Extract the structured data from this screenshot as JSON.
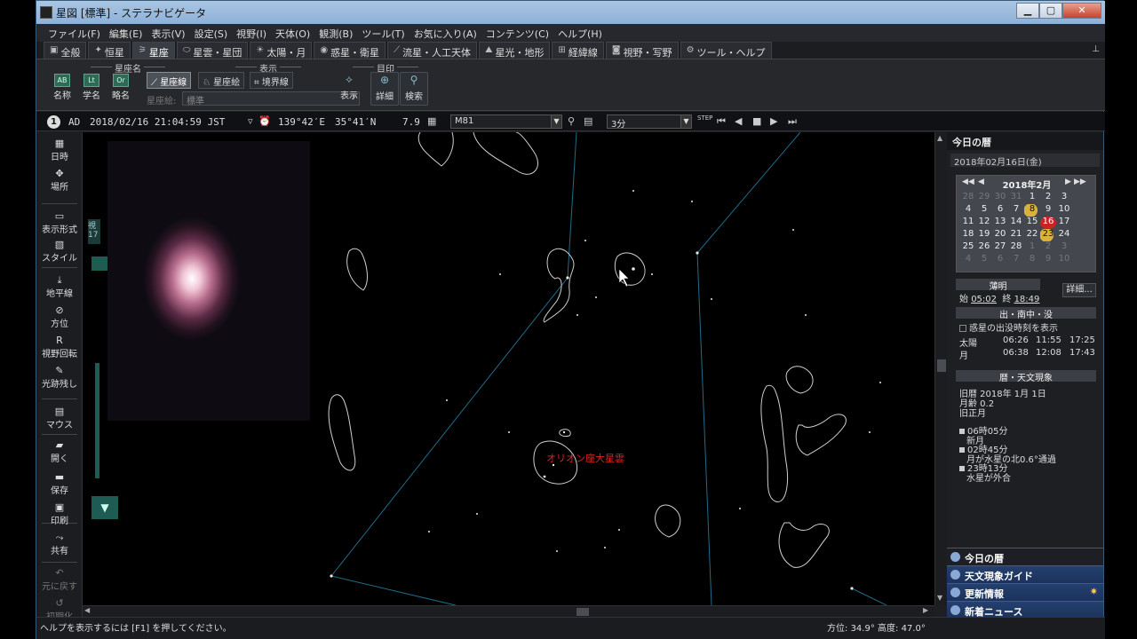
{
  "window": {
    "title": "星図 [標準] - ステラナビゲータ"
  },
  "menu": [
    "ファイル(F)",
    "編集(E)",
    "表示(V)",
    "設定(S)",
    "視野(I)",
    "天体(O)",
    "観測(B)",
    "ツール(T)",
    "お気に入り(A)",
    "コンテンツ(C)",
    "ヘルプ(H)"
  ],
  "tabs": [
    {
      "label": "全般",
      "icon": "grid-icon"
    },
    {
      "label": "恒星",
      "icon": "star-icon"
    },
    {
      "label": "星座",
      "icon": "constellation-icon",
      "active": true
    },
    {
      "label": "星雲・星団",
      "icon": "nebula-icon"
    },
    {
      "label": "太陽・月",
      "icon": "sun-icon"
    },
    {
      "label": "惑星・衛星",
      "icon": "planet-icon"
    },
    {
      "label": "流星・人工天体",
      "icon": "meteor-icon"
    },
    {
      "label": "星光・地形",
      "icon": "landscape-icon"
    },
    {
      "label": "経緯線",
      "icon": "grid-lines-icon"
    },
    {
      "label": "視野・写野",
      "icon": "camera-icon"
    },
    {
      "label": "ツール・ヘルプ",
      "icon": "gear-icon"
    }
  ],
  "ribbon": {
    "group_names": "星座名",
    "group_display": "表示",
    "group_mark": "目印",
    "name_btn": "名称",
    "latin_btn": "学名",
    "abbr_btn": "略名",
    "lines_btn": "星座線",
    "art_btn": "星座絵",
    "boundary_btn": "境界線",
    "art_label": "星座絵:",
    "art_value": "標準",
    "show_btn": "表示",
    "detail_btn": "詳細",
    "search_btn": "検索"
  },
  "status": {
    "circle": "1",
    "era": "AD",
    "datetime": "2018/02/16 21:04:59 JST",
    "longitude": "139°42′E",
    "latitude": "35°41′N",
    "magnitude": "7.9",
    "target": "M81",
    "step": "3分"
  },
  "left_toolbar": [
    "日時",
    "場所",
    "表示形式",
    "スタイル",
    "地平線",
    "方位",
    "視野回転",
    "光跡残し",
    "マウス",
    "開く",
    "保存",
    "印刷",
    "共有",
    "元に戻す",
    "初期化"
  ],
  "sky": {
    "object_label": "オリオン座大星雲",
    "side_text": "視",
    "side_num": "17"
  },
  "right_panel": {
    "header": "今日の暦",
    "date": "2018年02月16日(金)",
    "calendar_title": "2018年2月",
    "calendar_days": [
      {
        "d": "28",
        "dim": true
      },
      {
        "d": "29",
        "dim": true
      },
      {
        "d": "30",
        "dim": true
      },
      {
        "d": "31",
        "dim": true
      },
      {
        "d": "1"
      },
      {
        "d": "2"
      },
      {
        "d": "3"
      },
      {
        "d": "4"
      },
      {
        "d": "5"
      },
      {
        "d": "6"
      },
      {
        "d": "7"
      },
      {
        "d": "8",
        "moon": true
      },
      {
        "d": "9"
      },
      {
        "d": "10"
      },
      {
        "d": "11"
      },
      {
        "d": "12"
      },
      {
        "d": "13"
      },
      {
        "d": "14"
      },
      {
        "d": "15"
      },
      {
        "d": "16",
        "today": true
      },
      {
        "d": "17"
      },
      {
        "d": "18"
      },
      {
        "d": "19"
      },
      {
        "d": "20"
      },
      {
        "d": "21"
      },
      {
        "d": "22"
      },
      {
        "d": "23",
        "moon": true
      },
      {
        "d": "24"
      },
      {
        "d": "25"
      },
      {
        "d": "26"
      },
      {
        "d": "27"
      },
      {
        "d": "28"
      },
      {
        "d": "1",
        "dim": true
      },
      {
        "d": "2",
        "dim": true
      },
      {
        "d": "3",
        "dim": true
      },
      {
        "d": "4",
        "dim": true
      },
      {
        "d": "5",
        "dim": true
      },
      {
        "d": "6",
        "dim": true
      },
      {
        "d": "7",
        "dim": true
      },
      {
        "d": "8",
        "dim": true
      },
      {
        "d": "9",
        "dim": true
      },
      {
        "d": "10",
        "dim": true
      }
    ],
    "twilight_title": "薄明",
    "twilight_start_label": "始",
    "twilight_start": "05:02",
    "twilight_end_label": "終",
    "twilight_end": "18:49",
    "detail_btn": "詳細...",
    "rise_title": "出・南中・没",
    "planet_checkbox": "惑星の出没時刻を表示",
    "sun_label": "太陽",
    "sun_rise": "06:26",
    "sun_transit": "11:55",
    "sun_set": "17:25",
    "moon_label": "月",
    "moon_rise": "06:38",
    "moon_transit": "12:08",
    "moon_set": "17:43",
    "events_title": "暦・天文現象",
    "lunar_date": "旧暦 2018年 1月 1日",
    "moon_age": "月齢 0.2",
    "lunar_new_year": "旧正月",
    "ev1_time": "06時05分",
    "ev1_desc": "新月",
    "ev2_time": "02時45分",
    "ev2_desc": "月が水星の北0.6°通過",
    "ev3_time": "23時13分",
    "ev3_desc": "水星が外合",
    "footer_items": [
      "今日の暦",
      "天文現象ガイド",
      "更新情報",
      "新着ニュース"
    ]
  },
  "bottom": {
    "help": "ヘルプを表示するには [F1] を押してください。",
    "azimuth_label": "方位:",
    "azimuth": "34.9°",
    "altitude_label": "高度:",
    "altitude": "47.0°"
  }
}
